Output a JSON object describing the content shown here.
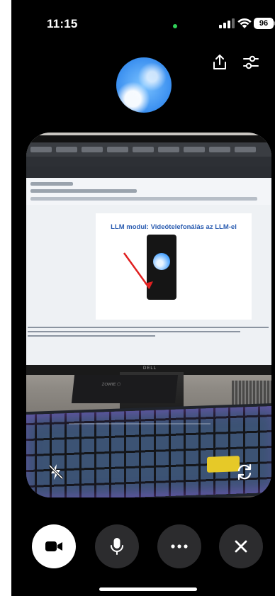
{
  "status_bar": {
    "time": "11:15",
    "battery_level": "96",
    "mic_in_use_color": "#30d158"
  },
  "top_actions": {
    "share_icon": "share-icon",
    "settings_icon": "sliders-icon"
  },
  "assistant_avatar": {
    "icon": "blue-orb"
  },
  "camera_preview": {
    "document_title": "LLM modul: Videótelefonálás az LLM-el",
    "flash_icon": "flash-off-icon",
    "flip_icon": "camera-flip-icon",
    "monitor_brand": "DELL",
    "pad_text": "ZOWIE ⬡"
  },
  "controls": [
    {
      "name": "video",
      "icon": "video-camera-icon"
    },
    {
      "name": "microphone",
      "icon": "microphone-icon"
    },
    {
      "name": "more",
      "icon": "ellipsis-icon"
    },
    {
      "name": "end-call",
      "icon": "close-icon"
    }
  ],
  "colors": {
    "background": "#000000",
    "control_bg": "#2c2c2e",
    "active_control_bg": "#ffffff",
    "avatar_blue": "#3a8ff0"
  }
}
